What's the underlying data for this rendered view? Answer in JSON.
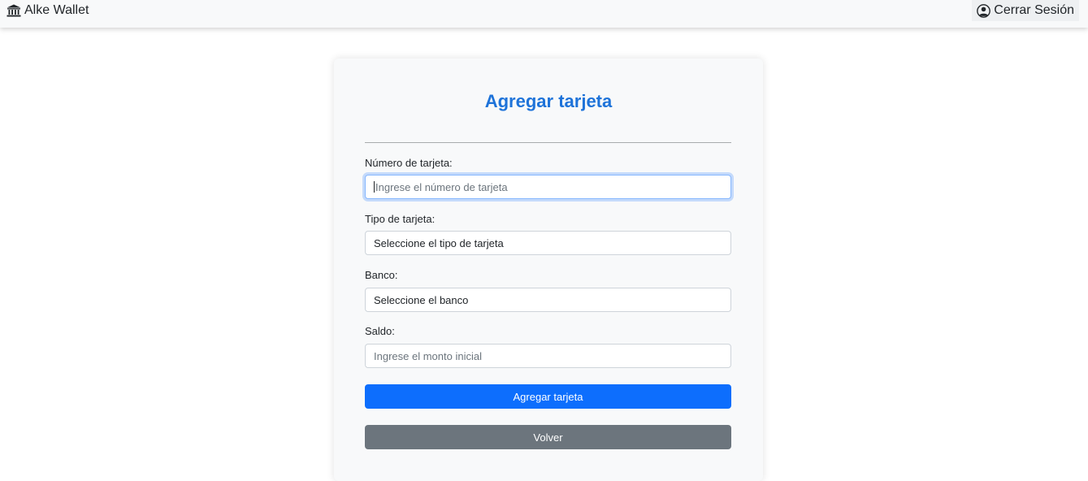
{
  "navbar": {
    "brand_label": "Alke Wallet",
    "brand_icon": "bank-icon",
    "logout_label": "Cerrar Sesión",
    "logout_icon": "user-circle-icon"
  },
  "form": {
    "title": "Agregar tarjeta",
    "card_number": {
      "label": "Número de tarjeta:",
      "placeholder": "Ingrese el número de tarjeta",
      "value": ""
    },
    "card_type": {
      "label": "Tipo de tarjeta:",
      "selected": "Seleccione el tipo de tarjeta"
    },
    "bank": {
      "label": "Banco:",
      "selected": "Seleccione el banco"
    },
    "balance": {
      "label": "Saldo:",
      "placeholder": "Ingrese el monto inicial",
      "value": ""
    },
    "submit_label": "Agregar tarjeta",
    "back_label": "Volver"
  },
  "colors": {
    "accent": "#0d6efd",
    "title": "#1e73d9",
    "secondary": "#6c757d",
    "panel": "#f8f9fa"
  }
}
